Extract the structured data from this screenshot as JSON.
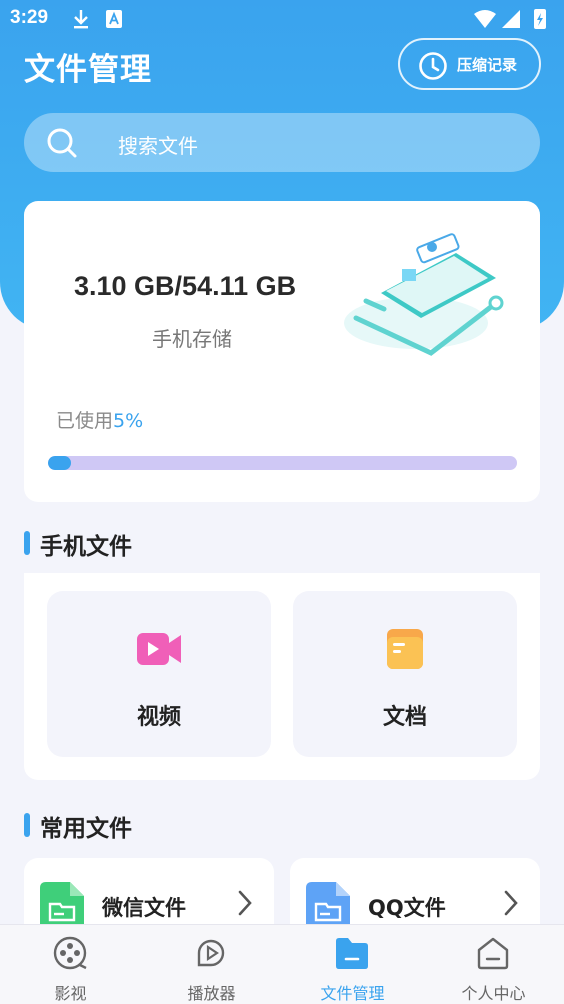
{
  "status_bar": {
    "time": "3:29"
  },
  "header": {
    "title": "文件管理",
    "history_button_label": "压缩记录"
  },
  "search": {
    "placeholder": "搜索文件"
  },
  "storage": {
    "amount": "3.10 GB/54.11 GB",
    "label": "手机存储",
    "used_prefix": "已使用",
    "used_percent_text": "5%",
    "used_fraction": 0.05
  },
  "phone_files": {
    "title": "手机文件",
    "tiles": [
      {
        "label": "视频",
        "icon": "video-icon"
      },
      {
        "label": "文档",
        "icon": "document-icon"
      }
    ]
  },
  "common_files": {
    "title": "常用文件",
    "items": [
      {
        "label": "微信文件",
        "icon": "wechat-file-icon"
      },
      {
        "label": "QQ文件",
        "icon": "qq-file-icon"
      }
    ]
  },
  "bottom_nav": {
    "items": [
      {
        "label": "影视",
        "icon": "film-reel-icon"
      },
      {
        "label": "播放器",
        "icon": "play-icon"
      },
      {
        "label": "文件管理",
        "icon": "folder-icon"
      },
      {
        "label": "个人中心",
        "icon": "home-icon"
      }
    ],
    "active_index": 2
  },
  "colors": {
    "accent": "#3aa3ee",
    "progress_track": "#cfc8f5",
    "background": "#f3f4fb"
  }
}
